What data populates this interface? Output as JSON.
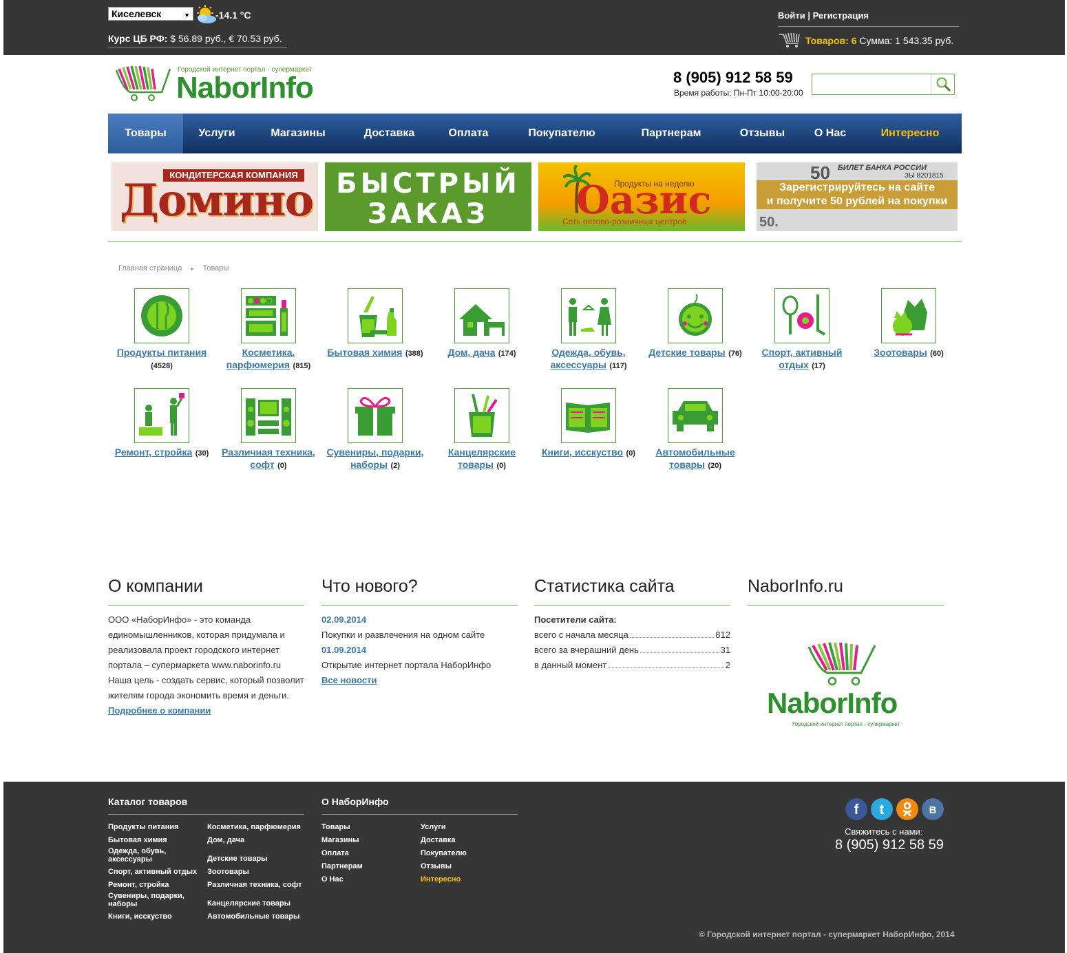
{
  "topbar": {
    "city": "Киселевск",
    "temperature": "-14.1 °C",
    "rates_label": "Курс ЦБ РФ:",
    "rates_value": "$ 56.89 руб., € 70.53 руб.",
    "login": "Войти",
    "separator": "|",
    "register": "Регистрация",
    "cart_label": "Товаров:",
    "cart_count": "6",
    "cart_sum": "Сумма: 1 543.35 руб."
  },
  "header": {
    "logo_tagline": "Городской интернет портал - супермаркет",
    "logo_text": "NaborInfo",
    "phone": "8 (905) 912 58 59",
    "hours": "Время работы: Пн-Пт 10:00-20:00",
    "search_placeholder": ""
  },
  "nav": [
    {
      "label": "Товары",
      "active": true
    },
    {
      "label": "Услуги"
    },
    {
      "label": "Магазины"
    },
    {
      "label": "Доставка"
    },
    {
      "label": "Оплата"
    },
    {
      "label": "Покупателю"
    },
    {
      "label": "Партнерам"
    },
    {
      "label": "Отзывы"
    },
    {
      "label": "О Нас"
    },
    {
      "label": "Интересно",
      "highlight": true
    }
  ],
  "banners": {
    "domino_header": "КОНДИТЕРСКАЯ КОМПАНИЯ",
    "domino_text": "Домино",
    "fast_line1": "БЫСТРЫЙ",
    "fast_line2": "ЗАКАЗ",
    "oasis_sub": "Продукты на неделю",
    "oasis_text": "Оазис",
    "oasis_foot": "Сеть оптово-розничных центров",
    "bank_num": "50",
    "bank_note": "БИЛЕТ БАНКА РОССИИ",
    "bank_serial": "ЗЫ 8201815",
    "bank_line1": "Зарегистрируйтесь на сайте",
    "bank_line2": "и получите 50 рублей на покупки",
    "bank_num2": "50."
  },
  "breadcrumb": {
    "home": "Главная страница",
    "arrow": "▸",
    "current": "Товары"
  },
  "categories": [
    {
      "name": "Продукты питания",
      "count": "(4528)",
      "icon": "plate-icon"
    },
    {
      "name": "Косметика, парфюмерия",
      "count": "(815)",
      "icon": "cosmetics-icon"
    },
    {
      "name": "Бытовая химия",
      "count": "(388)",
      "icon": "cleaning-icon"
    },
    {
      "name": "Дом, дача",
      "count": "(174)",
      "icon": "house-icon"
    },
    {
      "name": "Одежда, обувь, аксессуары",
      "count": "(117)",
      "icon": "clothes-icon"
    },
    {
      "name": "Детские товары",
      "count": "(76)",
      "icon": "baby-icon"
    },
    {
      "name": "Спорт, активный отдых",
      "count": "(17)",
      "icon": "sport-icon"
    },
    {
      "name": "Зоотовары",
      "count": "(60)",
      "icon": "pets-icon"
    },
    {
      "name": "Ремонт, стройка",
      "count": "(30)",
      "icon": "repair-icon"
    },
    {
      "name": "Различная техника, софт",
      "count": "(0)",
      "icon": "electronics-icon"
    },
    {
      "name": "Сувениры, подарки, наборы",
      "count": "(2)",
      "icon": "gift-icon"
    },
    {
      "name": "Канцелярские товары",
      "count": "(0)",
      "icon": "stationery-icon"
    },
    {
      "name": "Книги, исскуство",
      "count": "(0)",
      "icon": "books-icon"
    },
    {
      "name": "Автомобильные товары",
      "count": "(20)",
      "icon": "car-icon"
    }
  ],
  "about": {
    "title": "О компании",
    "text": "ООО «НаборИнфо» - это команда единомышленников, которая придумала и реализовала проект городского интернет портала – супермаркета www.naborinfo.ru Наша цель - создать сервис, который позволит жителям города экономить время и деньги.",
    "more": "Подробнее о компании"
  },
  "news": {
    "title": "Что нового?",
    "items": [
      {
        "date": "02.09.2014",
        "text": "Покупки и развлечения на одном сайте"
      },
      {
        "date": "01.09.2014",
        "text": "Открытие интернет портала НаборИнфо"
      }
    ],
    "all": "Все новости"
  },
  "stats": {
    "title": "Статистика сайта",
    "subtitle": "Посетители сайта:",
    "rows": [
      {
        "label": "всего с начала месяца",
        "value": "812"
      },
      {
        "label": "всего за вчерашний день",
        "value": "31"
      },
      {
        "label": "в данный момент",
        "value": "2"
      }
    ]
  },
  "brand": {
    "title": "NaborInfo.ru",
    "logo_text": "NaborInfo",
    "logo_tagline": "Городской интернет портал - супермаркет"
  },
  "footer": {
    "catalog_title": "Каталог товаров",
    "catalog_left": [
      "Продукты питания",
      "Бытовая химия",
      "Одежда, обувь,\nаксессуары",
      "Спорт, активный отдых",
      "Ремонт, стройка",
      "Сувениры, подарки,\nнаборы",
      "Книги, исскуство"
    ],
    "catalog_right": [
      "Косметика, парфюмерия",
      "Дом, дача",
      "Детские товары",
      "Зоотовары",
      "Различная техника, софт",
      "Канцелярские товары",
      "Автомобильные товары"
    ],
    "about_title": "О НаборИнфо",
    "about_left": [
      "Товары",
      "Магазины",
      "Оплата",
      "Партнерам",
      "О Нас"
    ],
    "about_right": [
      "Услуги",
      "Доставка",
      "Покупателю",
      "Отзывы",
      "Интересно"
    ],
    "contact": "Свяжитесь с нами:",
    "phone": "8 (905) 912 58 59",
    "copyright": "© Городской интернет портал - супермаркет НаборИнфо, 2014",
    "colors": {
      "facebook": "#3b5998",
      "twitter": "#2aa9e0",
      "odnoklassniki": "#f08a10",
      "vk": "#4c75a3"
    }
  }
}
